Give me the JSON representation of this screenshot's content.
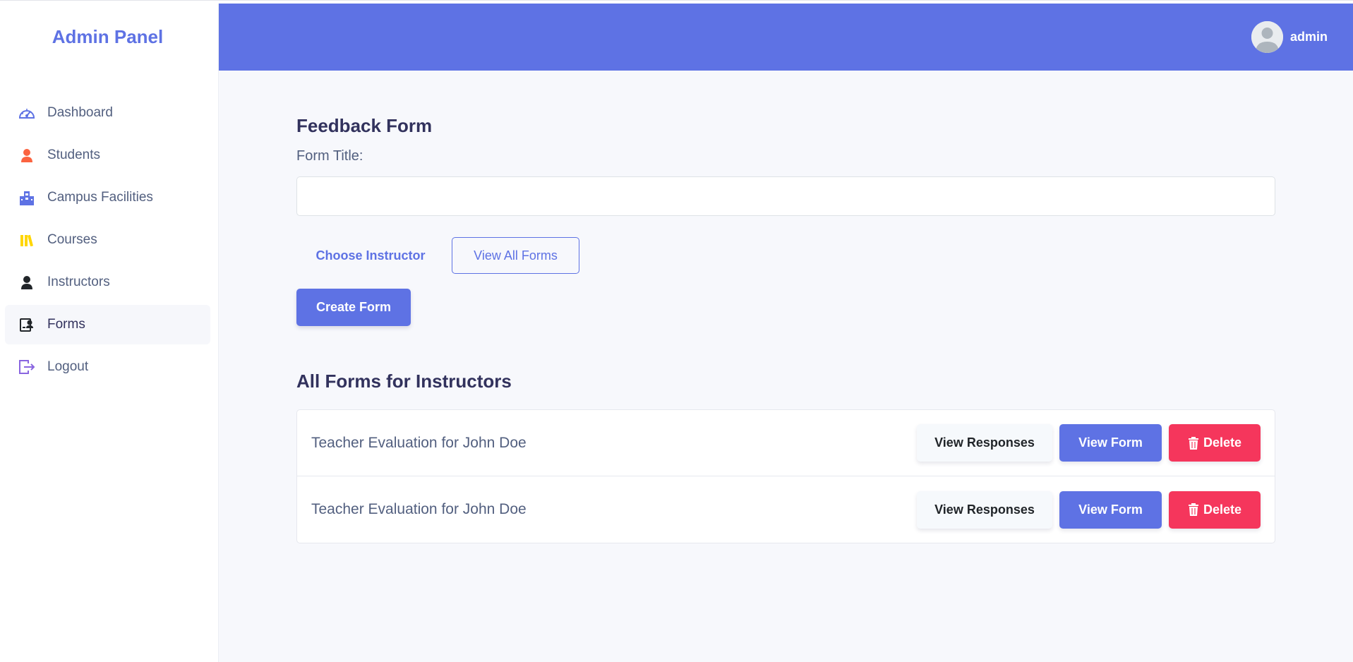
{
  "sidebar": {
    "brand": "Admin Panel",
    "items": [
      {
        "label": "Dashboard",
        "icon": "gauge-icon",
        "color": "#5e72e4"
      },
      {
        "label": "Students",
        "icon": "person-icon",
        "color": "#fb6340"
      },
      {
        "label": "Campus Facilities",
        "icon": "building-icon",
        "color": "#5e72e4"
      },
      {
        "label": "Courses",
        "icon": "books-icon",
        "color": "#ffd600"
      },
      {
        "label": "Instructors",
        "icon": "person-icon",
        "color": "#212529"
      },
      {
        "label": "Forms",
        "icon": "form-badge-icon",
        "color": "#212529",
        "active": true
      },
      {
        "label": "Logout",
        "icon": "logout-icon",
        "color": "#8965e0"
      }
    ]
  },
  "header": {
    "username": "admin",
    "color": "#5e72e4"
  },
  "form": {
    "heading": "Feedback Form",
    "title_label": "Form Title:",
    "title_value": "",
    "choose_instructor_label": "Choose Instructor",
    "view_all_label": "View All Forms",
    "create_label": "Create Form"
  },
  "list": {
    "heading": "All Forms for Instructors",
    "rows": [
      {
        "name": "Teacher Evaluation for John Doe",
        "responses_label": "View Responses",
        "view_label": "View Form",
        "delete_label": "Delete"
      },
      {
        "name": "Teacher Evaluation for John Doe",
        "responses_label": "View Responses",
        "view_label": "View Form",
        "delete_label": "Delete"
      }
    ]
  },
  "colors": {
    "primary": "#5e72e4",
    "danger": "#f5365c",
    "background": "#f7f8fc"
  }
}
